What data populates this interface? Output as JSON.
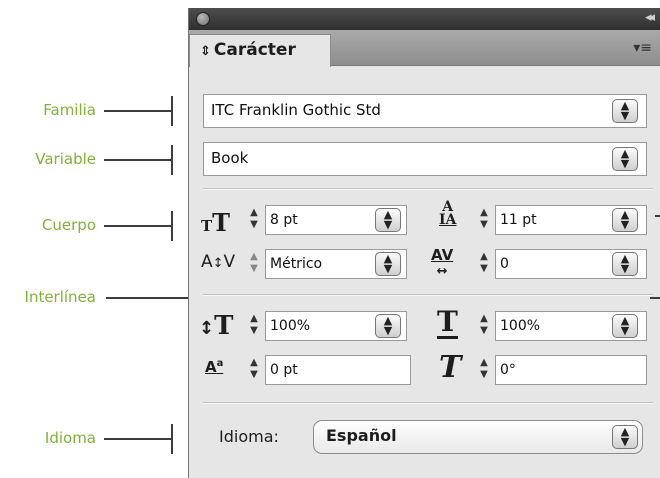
{
  "callouts": {
    "familia": "Familia",
    "variable": "Variable",
    "cuerpo": "Cuerpo",
    "interlinea": "Interlínea",
    "idioma": "Idioma"
  },
  "panel": {
    "tab_title": "Carácter",
    "tab_arrows": "⇕",
    "collapse_glyph": "◂◂",
    "menu_glyph": "▾≡"
  },
  "font": {
    "family": "ITC Franklin Gothic Std",
    "style": "Book"
  },
  "metrics": {
    "size": "8 pt",
    "leading": "11 pt",
    "kerning": "Métrico",
    "tracking": "0",
    "vertical_scale": "100%",
    "horizontal_scale": "100%",
    "baseline_shift": "0 pt",
    "skew": "0°"
  },
  "language": {
    "label": "Idioma:",
    "value": "Español"
  },
  "icons": {
    "font_size": "font-size-icon",
    "leading": "leading-icon",
    "kerning": "kerning-icon",
    "tracking": "tracking-icon",
    "vertical_scale": "vertical-scale-icon",
    "horizontal_scale": "horizontal-scale-icon",
    "baseline_shift": "baseline-shift-icon",
    "skew": "skew-icon"
  },
  "colors": {
    "callout_text": "#7fb239",
    "panel_bg": "#e6e6e6"
  }
}
